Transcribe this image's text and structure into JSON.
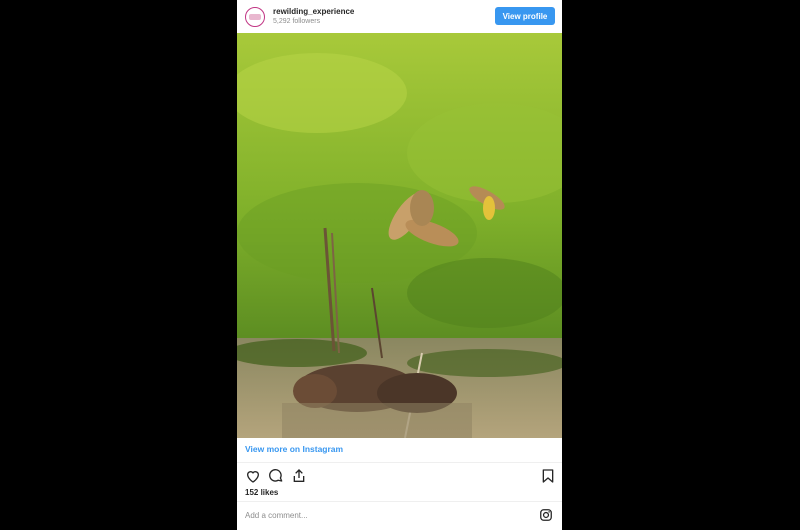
{
  "header": {
    "username": "rewilding_experience",
    "followers": "5,292 followers",
    "view_profile_label": "View profile"
  },
  "post": {
    "view_more_label": "View more on Instagram",
    "likes": "152 likes",
    "comment_placeholder": "Add a comment..."
  },
  "icons": [
    "heart-icon",
    "comment-icon",
    "share-icon",
    "bookmark-icon",
    "instagram-icon"
  ],
  "colors": {
    "link": "#3897f0",
    "button": "#3897f0",
    "background": "#000000"
  }
}
